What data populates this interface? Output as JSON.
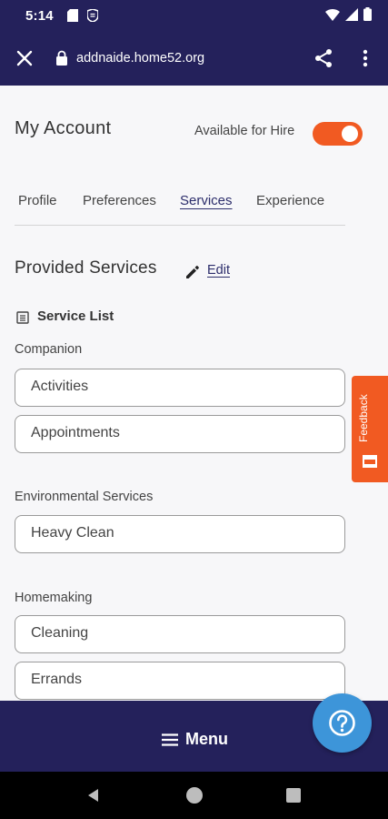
{
  "status_bar": {
    "time": "5:14",
    "icons": [
      "sd-card-icon",
      "shield-icon",
      "wifi-icon",
      "signal-icon",
      "battery-icon"
    ]
  },
  "browser": {
    "url": "addnaide.home52.org",
    "icons": [
      "close-icon",
      "lock-icon",
      "share-icon",
      "more-vert-icon"
    ]
  },
  "account": {
    "title": "My Account",
    "hire_label": "Available for Hire",
    "hire_on": true
  },
  "tabs": [
    {
      "label": "Profile",
      "active": false
    },
    {
      "label": "Preferences",
      "active": false
    },
    {
      "label": "Services",
      "active": true
    },
    {
      "label": "Experience",
      "active": false
    }
  ],
  "services": {
    "title": "Provided Services",
    "edit_label": "Edit",
    "list_title": "Service List",
    "categories": [
      {
        "name": "Companion",
        "items": [
          "Activities",
          "Appointments"
        ]
      },
      {
        "name": "Environmental Services",
        "items": [
          "Heavy Clean"
        ]
      },
      {
        "name": "Homemaking",
        "items": [
          "Cleaning",
          "Errands"
        ]
      }
    ]
  },
  "feedback_label": "Feedback",
  "menu_label": "Menu",
  "colors": {
    "header_bg": "#24215b",
    "accent": "#f15a22",
    "fab": "#3d95d9",
    "link": "#2c2d6b"
  }
}
